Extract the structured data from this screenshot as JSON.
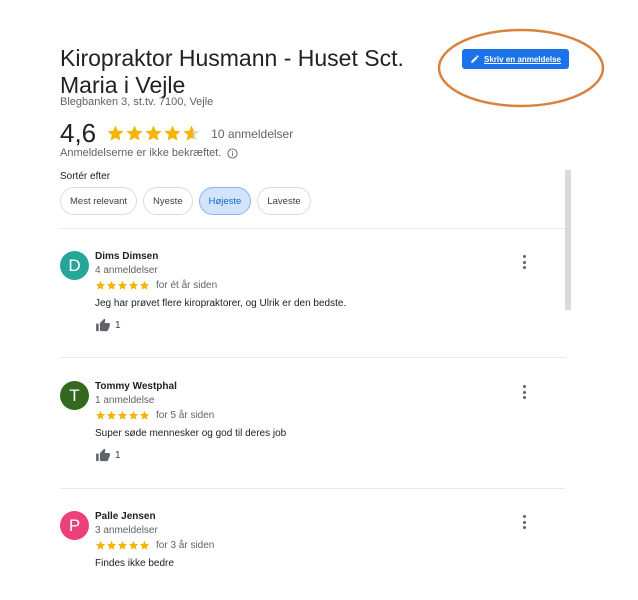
{
  "business": {
    "name": "Kiropraktor Husmann - Huset Sct. Maria i Vejle",
    "address": "Blegbanken 3, st.tv. 7100, Vejle",
    "rating": "4,6",
    "rating_value": 4.6,
    "review_count": "10 anmeldelser",
    "not_verified": "Anmeldelserne er ikke bekræftet."
  },
  "write_review_label": "Skriv en anmeldelse",
  "colors": {
    "accent": "#1a73e8",
    "star": "#f4b400",
    "highlight": "#d9823b",
    "chip_active_bg": "#d2e3fc"
  },
  "sort": {
    "label": "Sortér efter",
    "options": [
      "Mest relevant",
      "Nyeste",
      "Højeste",
      "Laveste"
    ],
    "selected": "Højeste"
  },
  "reviews": [
    {
      "initial": "D",
      "avatar_color": "#26a69a",
      "name": "Dims Dimsen",
      "sub": "4 anmeldelser",
      "stars": 5,
      "time": "for ét år siden",
      "text": "Jeg har prøvet flere kiropraktorer, og Ulrik er den bedste.",
      "likes": "1"
    },
    {
      "initial": "T",
      "avatar_color": "#33691e",
      "name": "Tommy Westphal",
      "sub": "1 anmeldelse",
      "stars": 5,
      "time": "for 5 år siden",
      "text": "Super søde mennesker og god til deres job",
      "likes": "1"
    },
    {
      "initial": "P",
      "avatar_color": "#ec407a",
      "name": "Palle Jensen",
      "sub": "3 anmeldelser",
      "stars": 5,
      "time": "for 3 år siden",
      "text": "Findes ikke bedre"
    }
  ]
}
